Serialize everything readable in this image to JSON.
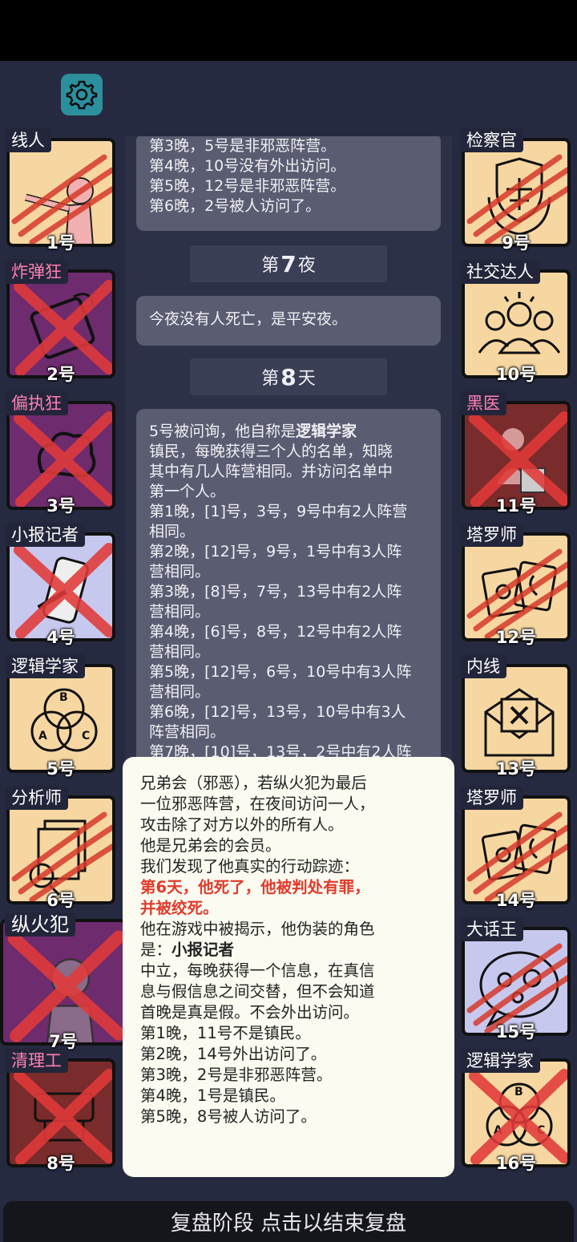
{
  "left_cards": [
    {
      "role": "线人",
      "num": "1号",
      "bg": "#f7d7a1",
      "role_pink": false,
      "mark": "claw",
      "dead_style": "scratch"
    },
    {
      "role": "炸弹狂",
      "num": "2号",
      "bg": "#6e2b6e",
      "role_pink": true,
      "mark": "x"
    },
    {
      "role": "偏执狂",
      "num": "3号",
      "bg": "#6e2b6e",
      "role_pink": true,
      "mark": "x"
    },
    {
      "role": "小报记者",
      "num": "4号",
      "bg": "#c7c8ee",
      "role_pink": false,
      "mark": "x"
    },
    {
      "role": "逻辑学家",
      "num": "5号",
      "bg": "#f7d7a1",
      "role_pink": false,
      "mark": "none"
    },
    {
      "role": "分析师",
      "num": "6号",
      "bg": "#f7d7a1",
      "role_pink": false,
      "mark": "claw"
    },
    {
      "role": "纵火犯",
      "num": "7号",
      "bg": "#6e2b6e",
      "role_pink": false,
      "mark": "x"
    },
    {
      "role": "清理工",
      "num": "8号",
      "bg": "#7a2b2b",
      "role_pink": true,
      "mark": "x"
    }
  ],
  "right_cards": [
    {
      "role": "检察官",
      "num": "9号",
      "bg": "#f7d7a1",
      "role_pink": false,
      "mark": "claw"
    },
    {
      "role": "社交达人",
      "num": "10号",
      "bg": "#f7d7a1",
      "role_pink": false,
      "mark": "none"
    },
    {
      "role": "黑医",
      "num": "11号",
      "bg": "#7a2b2b",
      "role_pink": true,
      "mark": "x"
    },
    {
      "role": "塔罗师",
      "num": "12号",
      "bg": "#f7d7a1",
      "role_pink": false,
      "mark": "claw"
    },
    {
      "role": "内线",
      "num": "13号",
      "bg": "#f7d7a1",
      "role_pink": false,
      "mark": "none"
    },
    {
      "role": "塔罗师",
      "num": "14号",
      "bg": "#f7d7a1",
      "role_pink": false,
      "mark": "claw"
    },
    {
      "role": "大话王",
      "num": "15号",
      "bg": "#c7c8ee",
      "role_pink": false,
      "mark": "claw"
    },
    {
      "role": "逻辑学家",
      "num": "16号",
      "bg": "#f7d7a1",
      "role_pink": false,
      "mark": "x"
    }
  ],
  "log": {
    "bubble1": [
      "第3晚，5号是非邪恶阵营。",
      "第4晚，10号没有外出访问。",
      "第5晚，12号是非邪恶阵营。",
      "第6晚，2号被人访问了。"
    ],
    "night7_pre": "第",
    "night7_num": "7",
    "night7_post": "夜",
    "bubble2": "今夜没有人死亡，是平安夜。",
    "day8_pre": "第",
    "day8_num": "8",
    "day8_post": "天",
    "bubble3_intro": "5号被问询，他自称是",
    "bubble3_role": "逻辑学家",
    "bubble3": [
      "镇民，每晚获得三个人的名单，知晓",
      "其中有几人阵营相同。并访问名单中",
      "第一个人。",
      "第1晚，[1]号，3号，9号中有2人阵营",
      "相同。",
      "第2晚，[12]号，9号，1号中有3人阵",
      "营相同。",
      "第3晚，[8]号，7号，13号中有2人阵",
      "营相同。",
      "第4晚，[6]号，8号，12号中有2人阵",
      "营相同。",
      "第5晚，[12]号，6号，10号中有3人阵",
      "营相同。",
      "第6晚，[12]号，13号，10号中有3人",
      "阵营相同。",
      "第7晚，[10]号，13号，2号中有2人阵"
    ]
  },
  "popup": {
    "lines_a": [
      "兄弟会（邪恶），若纵火犯为最后",
      "一位邪恶阵营，在夜间访问一人，",
      "攻击除了对方以外的所有人。",
      "他是兄弟会的会员。",
      "我们发现了他真实的行动踪迹："
    ],
    "red_lines": [
      "第6天，他死了，他被判处有罪，",
      "并被绞死。"
    ],
    "lines_b": [
      "他在游戏中被揭示，他伪装的角色"
    ],
    "fake_prefix": "是：",
    "fake_role": "小报记者",
    "lines_c": [
      "中立，每晚获得一个信息，在真信",
      "息与假信息之间交替，但不会知道",
      "首晚是真是假。不会外出访问。",
      "第1晚，11号不是镇民。",
      "第2晚，14号外出访问了。",
      "第3晚，2号是非邪恶阵营。",
      "第4晚，1号是镇民。",
      "第5晚，8号被人访问了。"
    ]
  },
  "bottom_bar": "复盘阶段 点击以结束复盘",
  "colors": {
    "claw": "#d63a2a",
    "x": "#e23a3a",
    "accent": "#2c8f9e"
  }
}
